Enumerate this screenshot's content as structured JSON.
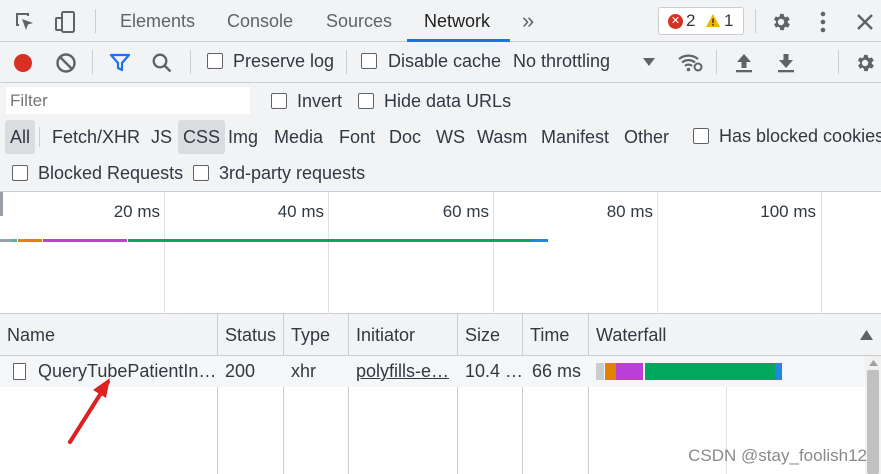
{
  "tabs": {
    "items": [
      {
        "label": "Elements"
      },
      {
        "label": "Console"
      },
      {
        "label": "Sources"
      },
      {
        "label": "Network"
      }
    ],
    "more": "»",
    "errors": "2",
    "warnings": "1"
  },
  "toolbar": {
    "preserve_log": "Preserve log",
    "disable_cache": "Disable cache",
    "throttling": "No throttling"
  },
  "filter": {
    "placeholder": "Filter",
    "invert": "Invert",
    "hide_data_urls": "Hide data URLs",
    "types": [
      "All",
      "Fetch/XHR",
      "JS",
      "CSS",
      "Img",
      "Media",
      "Font",
      "Doc",
      "WS",
      "Wasm",
      "Manifest",
      "Other"
    ],
    "has_blocked_cookies": "Has blocked cookies",
    "blocked_requests": "Blocked Requests",
    "third_party": "3rd-party requests"
  },
  "overview": {
    "ticks": [
      "20 ms",
      "40 ms",
      "60 ms",
      "80 ms",
      "100 ms"
    ]
  },
  "table": {
    "columns": [
      "Name",
      "Status",
      "Type",
      "Initiator",
      "Size",
      "Time",
      "Waterfall"
    ],
    "rows": [
      {
        "name": "QueryTubePatientIn…",
        "status": "200",
        "type": "xhr",
        "initiator": "polyfills-e…",
        "size": "10.4 …",
        "time": "66 ms"
      }
    ]
  },
  "colors": {
    "accent": "#1a73e8",
    "record": "#d93025",
    "waiting": "#00a85d",
    "download": "#1e88e5",
    "ssl": "#b93fd8",
    "connect": "#e08300"
  },
  "watermark": "CSDN @stay_foolish12"
}
